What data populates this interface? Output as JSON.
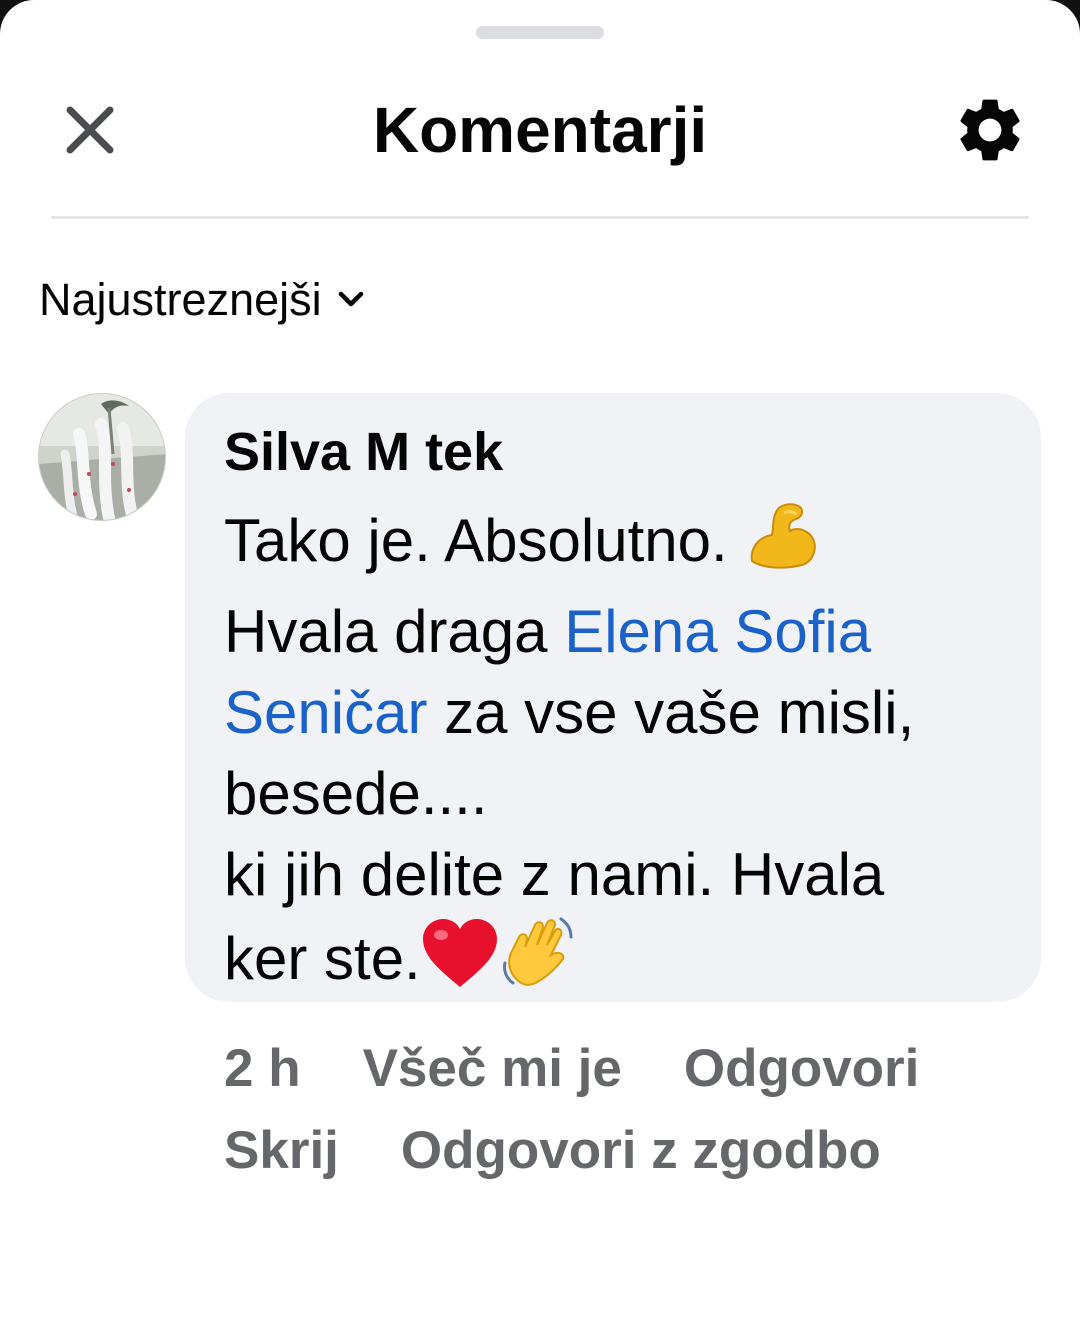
{
  "header": {
    "title": "Komentarji",
    "close_icon": "close-icon",
    "settings_icon": "gear-icon"
  },
  "sort": {
    "label": "Najustreznejši",
    "icon": "chevron-down-icon"
  },
  "comment": {
    "author": "Silva M  tek",
    "lines": {
      "line1": "Tako je. Absolutno.",
      "line2_prefix": "Hvala draga ",
      "mention_part1": "Elena Sofia",
      "mention_part2": "Seničar",
      "line3_suffix": " za vse vaše misli,",
      "line4": "besede....",
      "line5": "ki jih delite z nami. Hvala",
      "line6": "ker ste."
    },
    "emojis": [
      "flexed-biceps-icon",
      "red-heart-icon",
      "waving-hand-icon"
    ],
    "timestamp": "2 h",
    "actions": {
      "like": "Všeč mi je",
      "reply": "Odgovori",
      "hide": "Skrij",
      "reply_story": "Odgovori z zgodbo"
    }
  },
  "colors": {
    "mention": "#1a62c9",
    "bubble": "#f0f2f5",
    "meta": "#65676b",
    "text": "#050505"
  }
}
